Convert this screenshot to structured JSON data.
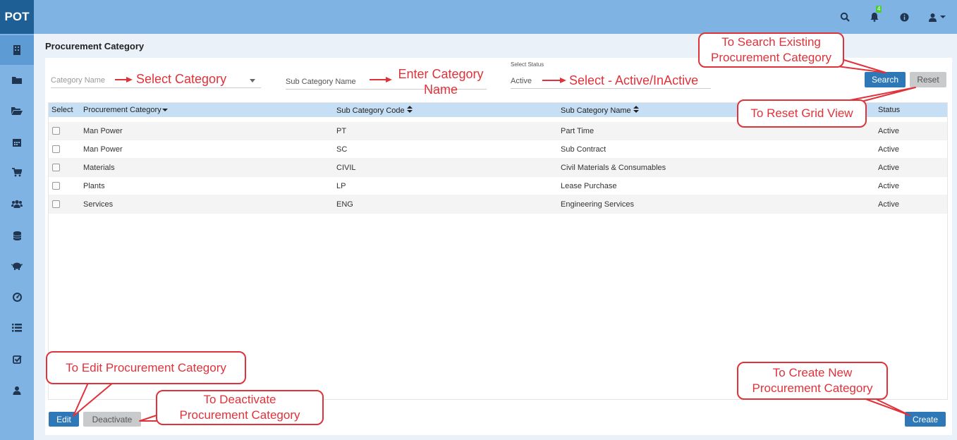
{
  "app": {
    "logo": "POT",
    "notification_count": "4"
  },
  "header": {
    "icons": [
      "search-icon",
      "bell-icon",
      "info-icon",
      "user-icon"
    ]
  },
  "sidebar": {
    "icons": [
      "building-icon",
      "folder-icon",
      "folder-open-icon",
      "calendar-icon",
      "cart-icon",
      "users-icon",
      "database-icon",
      "piggy-bank-icon",
      "dashboard-icon",
      "list-icon",
      "checkbox-icon",
      "user-icon"
    ]
  },
  "page": {
    "title": "Procurement Category"
  },
  "filters": {
    "category_placeholder": "Category Name",
    "subcategory_placeholder": "Sub Category Name",
    "status_label": "Select Status",
    "status_value": "Active",
    "search_label": "Search",
    "reset_label": "Reset"
  },
  "grid": {
    "headers": [
      "Select",
      "Procurement Category",
      "Sub Category Code",
      "Sub Category Name",
      "Status"
    ],
    "rows": [
      {
        "category": "Man Power",
        "code": "PT",
        "name": "Part Time",
        "status": "Active"
      },
      {
        "category": "Man Power",
        "code": "SC",
        "name": "Sub Contract",
        "status": "Active"
      },
      {
        "category": "Materials",
        "code": "CIVIL",
        "name": "Civil Materials & Consumables",
        "status": "Active"
      },
      {
        "category": "Plants",
        "code": "LP",
        "name": "Lease Purchase",
        "status": "Active"
      },
      {
        "category": "Services",
        "code": "ENG",
        "name": "Engineering Services",
        "status": "Active"
      }
    ]
  },
  "footer": {
    "edit_label": "Edit",
    "deactivate_label": "Deactivate",
    "create_label": "Create"
  },
  "annotations": {
    "select_category": "Select Category",
    "enter_category_line1": "Enter Category",
    "enter_category_line2": "Name",
    "select_status": "Select - Active/InActive",
    "search_existing_line1": "To Search Existing",
    "search_existing_line2": "Procurement Category",
    "reset_grid": "To Reset Grid View",
    "edit": "To Edit Procurement Category",
    "deactivate_line1": "To Deactivate",
    "deactivate_line2": "Procurement Category",
    "create_line1": "To Create New",
    "create_line2": "Procurement Category"
  },
  "colors": {
    "topbar": "#7fb3e3",
    "logo_bg": "#1e5f96",
    "primary": "#2f78b7",
    "annotation": "#e0323a",
    "grid_header": "#c7dff4"
  }
}
